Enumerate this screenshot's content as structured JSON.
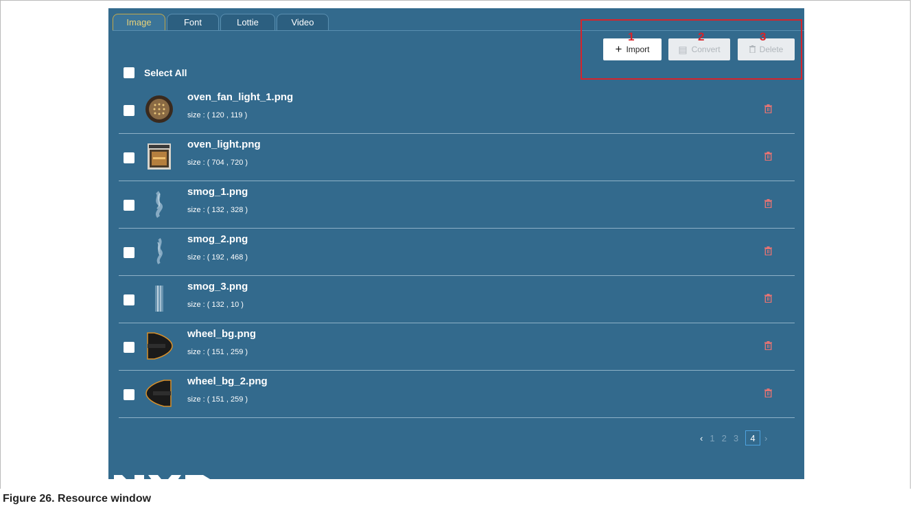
{
  "tabs": [
    "Image",
    "Font",
    "Lottie",
    "Video"
  ],
  "toolbar": {
    "import_label": "Import",
    "convert_label": "Convert",
    "delete_label": "Delete"
  },
  "callouts": [
    "1",
    "2",
    "3"
  ],
  "select_all_label": "Select All",
  "files": [
    {
      "name": "oven_fan_light_1.png",
      "size": "size : ( 120 , 119 )"
    },
    {
      "name": "oven_light.png",
      "size": "size : ( 704 , 720 )"
    },
    {
      "name": "smog_1.png",
      "size": "size : ( 132 , 328 )"
    },
    {
      "name": "smog_2.png",
      "size": "size : ( 192 , 468 )"
    },
    {
      "name": "smog_3.png",
      "size": "size : ( 132 , 10 )"
    },
    {
      "name": "wheel_bg.png",
      "size": "size : ( 151 , 259 )"
    },
    {
      "name": "wheel_bg_2.png",
      "size": "size : ( 151 , 259 )"
    }
  ],
  "pagination": {
    "pages": [
      "1",
      "2",
      "3",
      "4"
    ],
    "current": "4"
  },
  "caption": "Figure 26.  Resource window",
  "colors": {
    "panel": "#336a8d",
    "accent_tab": "#e9d27a",
    "trash": "#e57373",
    "callout": "#d8232a"
  }
}
